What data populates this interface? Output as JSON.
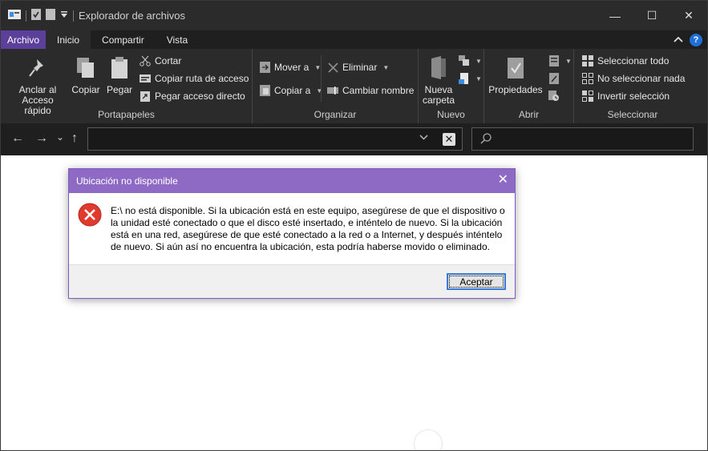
{
  "window": {
    "title": "Explorador de archivos",
    "controls": {
      "minimize": "—",
      "maximize": "☐",
      "close": "✕"
    }
  },
  "tabs": {
    "file": "Archivo",
    "items": [
      "Inicio",
      "Compartir",
      "Vista"
    ],
    "active": "Inicio",
    "help": "?"
  },
  "ribbon": {
    "portapapeles": {
      "label": "Portapapeles",
      "pin_label_1": "Anclar al",
      "pin_label_2": "Acceso rápido",
      "copy": "Copiar",
      "paste": "Pegar",
      "cut": "Cortar",
      "copy_path": "Copiar ruta de acceso",
      "paste_shortcut": "Pegar acceso directo"
    },
    "organizar": {
      "label": "Organizar",
      "move_to": "Mover a",
      "copy_to": "Copiar a",
      "delete": "Eliminar",
      "rename": "Cambiar nombre"
    },
    "nuevo": {
      "label": "Nuevo",
      "new_folder_1": "Nueva",
      "new_folder_2": "carpeta"
    },
    "abrir": {
      "label": "Abrir",
      "properties": "Propiedades"
    },
    "seleccionar": {
      "label": "Seleccionar",
      "select_all": "Seleccionar todo",
      "select_none": "No seleccionar nada",
      "invert": "Invertir selección"
    }
  },
  "navigation": {
    "back": "←",
    "forward": "→",
    "recent": "⌄",
    "up": "↑",
    "address_value": "",
    "search_value": ""
  },
  "dialog": {
    "title": "Ubicación no disponible",
    "close": "✕",
    "message": "E:\\ no está disponible. Si la ubicación está en este equipo, asegúrese de que el dispositivo o la unidad esté conectado o que el disco esté insertado, e inténtelo de nuevo. Si la ubicación está en una red, asegúrese de que esté conectado a la red o a Internet, y después inténtelo de nuevo. Si aún así no encuentra la ubicación, esta podría haberse movido o eliminado.",
    "accept": "Aceptar",
    "icon": "error-icon"
  },
  "colors": {
    "titlebar": "#2b2b2b",
    "ribbon": "#2b2b2b",
    "file_tab": "#5c3f9a",
    "dialog_title": "#8e6ac4",
    "error_red": "#e03a2f",
    "button_border": "#3b7ad6"
  }
}
